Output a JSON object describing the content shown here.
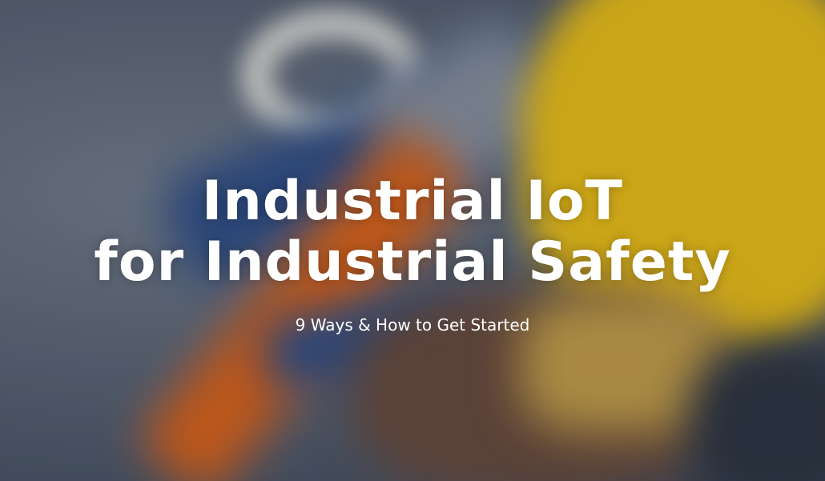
{
  "hero": {
    "title_line1": "Industrial IoT",
    "title_line2": "for Industrial Safety",
    "subtitle": "9 Ways & How to Get Started"
  },
  "colors": {
    "helmet": "#f2c417",
    "strap_orange": "#e0641a",
    "strap_blue": "#2c4f8c",
    "glove": "#6a4b3d",
    "background": "#5b6678",
    "text": "#ffffff"
  }
}
